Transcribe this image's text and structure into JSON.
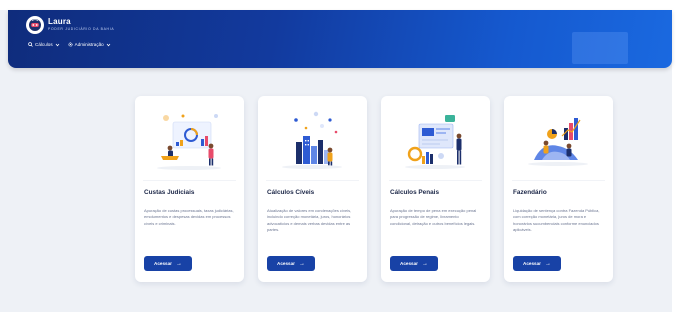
{
  "header": {
    "brand_name": "Laura",
    "brand_subtitle": "PODER JUDICIÁRIO DA BAHIA",
    "nav": [
      {
        "icon": "search-icon",
        "label": "Cálculos"
      },
      {
        "icon": "gear-icon",
        "label": "Administração"
      }
    ]
  },
  "cards": [
    {
      "title": "Custas Judiciais",
      "description": "Apuração de custas processuais, taxas judiciárias, emolumentos e despesas devidas em processos cíveis e criminais.",
      "button_label": "Acessar",
      "button_icon": "arrow-right-icon",
      "illustration": "finance-dashboard-illustration"
    },
    {
      "title": "Cálculos Cíveis",
      "description": "Atualização de valores em condenações cíveis, incluindo correção monetária, juros, honorários advocatícios e demais verbas devidas entre as partes.",
      "button_label": "Acessar",
      "button_icon": "arrow-right-icon",
      "illustration": "city-buildings-illustration"
    },
    {
      "title": "Cálculos Penais",
      "description": "Apuração de tempo de pena em execução penal para progressão de regime, livramento condicional, detração e outros benefícios legais.",
      "button_label": "Acessar",
      "button_icon": "arrow-right-icon",
      "illustration": "presentation-board-illustration"
    },
    {
      "title": "Fazendário",
      "description": "Liquidação de sentença contra Fazenda Pública, com correção monetária, juros de mora e honorários sucumbenciais conforme enunciados aplicáveis.",
      "button_label": "Acessar",
      "button_icon": "arrow-right-icon",
      "illustration": "analytics-growth-illustration"
    }
  ],
  "colors": {
    "header_dark": "#0f2c7c",
    "header_light": "#1a69e0",
    "button": "#1842a6",
    "accent_orange": "#f0a21b",
    "page_background": "#eef1f6"
  }
}
